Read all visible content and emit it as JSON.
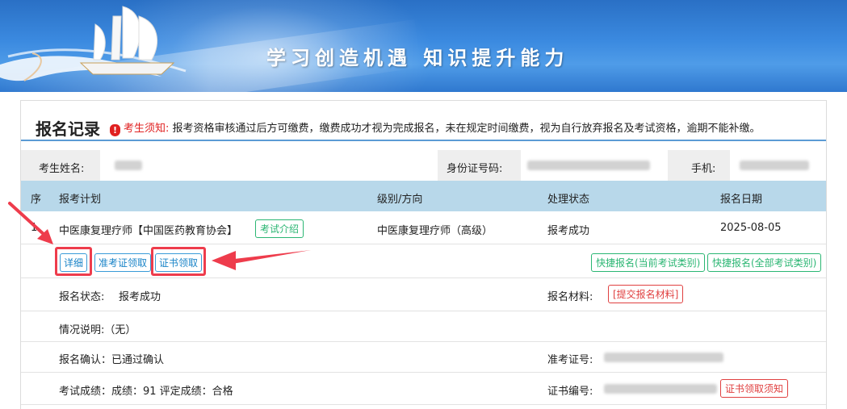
{
  "banner": {
    "slogan": "学习创造机遇  知识提升能力"
  },
  "header": {
    "title": "报名记录",
    "notice_label": "考生须知:",
    "notice_text": "报考资格审核通过后方可缴费，缴费成功才视为完成报名，未在规定时间缴费，视为自行放弃报名及考试资格，逾期不能补缴。"
  },
  "info": {
    "name_label": "考生姓名:",
    "id_label": "身份证号码:",
    "phone_label": "手机:"
  },
  "table": {
    "headers": [
      "序",
      "报考计划",
      "级别/方向",
      "处理状态",
      "报名日期"
    ],
    "record": {
      "index": "1",
      "plan": "中医康复理疗师【中国医药教育协会】",
      "intro_button": "考试介绍",
      "level": "中医康复理疗师（高级）",
      "status": "报考成功",
      "date": "2025-08-05"
    }
  },
  "actions": {
    "detail": "详细",
    "admission": "准考证领取",
    "certificate": "证书领取",
    "quick_current": "快捷报名(当前考试类别)",
    "quick_all": "快捷报名(全部考试类别)"
  },
  "details": {
    "status_label": "报名状态:",
    "status_value": "报考成功",
    "material_label": "报名材料:",
    "material_button": "[提交报名材料]",
    "situation": "情况说明:（无）",
    "confirm": "报名确认：已通过确认",
    "admission_no_label": "准考证号:",
    "score": "考试成绩：成绩：91 评定成绩：合格",
    "cert_no_label": "证书编号:",
    "cert_notice_button": "证书领取须知"
  },
  "colors": {
    "accent": "#5b9bd5",
    "table_header": "#b8d8ea",
    "danger": "#e02020",
    "success": "#2bb673",
    "highlight": "#ee3c4c"
  }
}
